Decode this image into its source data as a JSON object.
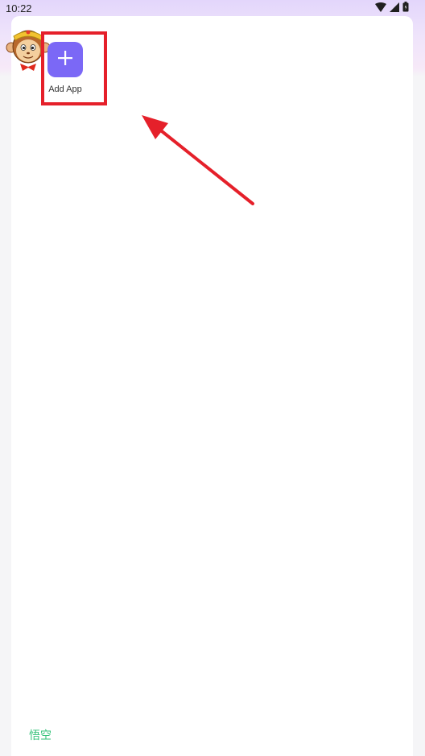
{
  "status_bar": {
    "time": "10:22",
    "icons": [
      "wifi-icon",
      "signal-icon",
      "battery-icon"
    ]
  },
  "app_grid": {
    "tiles": [
      {
        "label": "Add App",
        "icon": "plus-icon"
      }
    ]
  },
  "annotation": {
    "highlight_color": "#e5202a",
    "arrow_color": "#e5202a"
  },
  "footer": {
    "brand": "悟空",
    "brand_color": "#35c27a"
  },
  "colors": {
    "accent": "#7b68f6"
  }
}
